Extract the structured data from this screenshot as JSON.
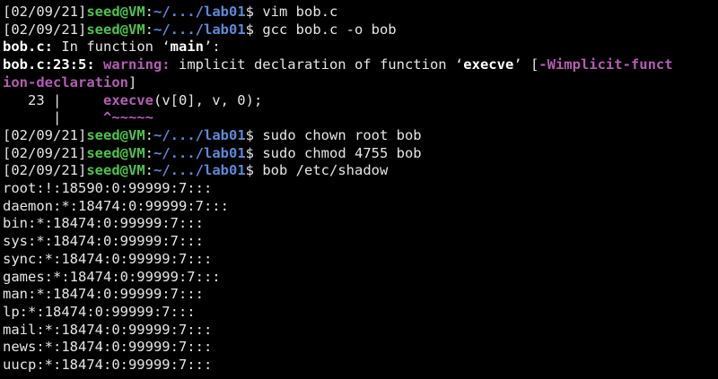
{
  "terminal": {
    "colors": {
      "background": "#000000",
      "text": "#e5e5e5",
      "user_host": "#4ec24e",
      "path": "#5c8ad8",
      "warning": "#b35cb3",
      "bold_white": "#ffffff"
    },
    "prompt": {
      "date": "[02/09/21]",
      "user_host": "seed@VM",
      "sep": ":",
      "path": "~/.../lab01",
      "dollar": "$"
    },
    "commands": [
      " vim bob.c",
      " gcc bob.c -o bob",
      " sudo chown root bob",
      " sudo chmod 4755 bob",
      " bob /etc/shadow"
    ],
    "gcc_output": {
      "file1": "bob.c:",
      "in_function": " In function ‘",
      "func_main": "main",
      "in_function_end": "’:",
      "loc": "bob.c:23:5:",
      "warning_label": " warning:",
      "warning_text": " implicit declaration of function ‘",
      "func_execve": "execve",
      "warning_text_end": "’ [",
      "flag_part1": "-Wimplicit-funct",
      "flag_part2": "ion-declaration",
      "flag_close": "]",
      "code_line_no": "   23 |     ",
      "code_execve": "execve",
      "code_rest": "(v[0], v, 0);",
      "caret_prefix": "      |     ",
      "caret": "^~~~~~"
    },
    "shadow_lines": [
      "root:!:18590:0:99999:7:::",
      "daemon:*:18474:0:99999:7:::",
      "bin:*:18474:0:99999:7:::",
      "sys:*:18474:0:99999:7:::",
      "sync:*:18474:0:99999:7:::",
      "games:*:18474:0:99999:7:::",
      "man:*:18474:0:99999:7:::",
      "lp:*:18474:0:99999:7:::",
      "mail:*:18474:0:99999:7:::",
      "news:*:18474:0:99999:7:::",
      "uucp:*:18474:0:99999:7:::"
    ]
  }
}
